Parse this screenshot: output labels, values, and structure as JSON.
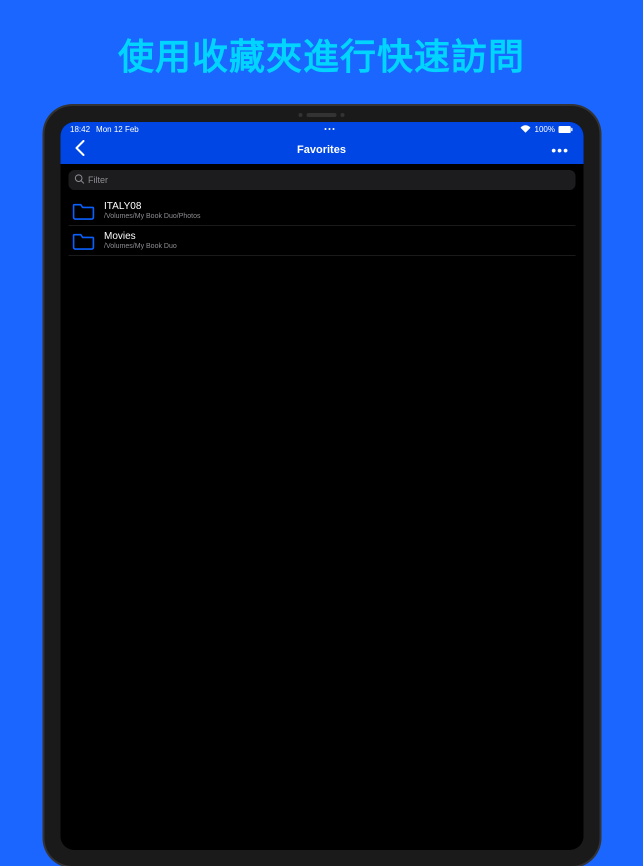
{
  "promo": {
    "title": "使用收藏夾進行快速訪問"
  },
  "statusBar": {
    "time": "18:42",
    "date": "Mon 12 Feb",
    "battery": "100%"
  },
  "navBar": {
    "title": "Favorites",
    "moreGlyph": "•••"
  },
  "filter": {
    "placeholder": "Filter"
  },
  "list": {
    "items": [
      {
        "title": "ITALY08",
        "subtitle": "/Volumes/My Book Duo/Photos"
      },
      {
        "title": "Movies",
        "subtitle": "/Volumes/My Book Duo"
      }
    ]
  },
  "colors": {
    "accent": "#0046e5",
    "promoBg": "#1a66ff",
    "promoText": "#00d4ff",
    "folderStroke": "#0a60ff"
  }
}
